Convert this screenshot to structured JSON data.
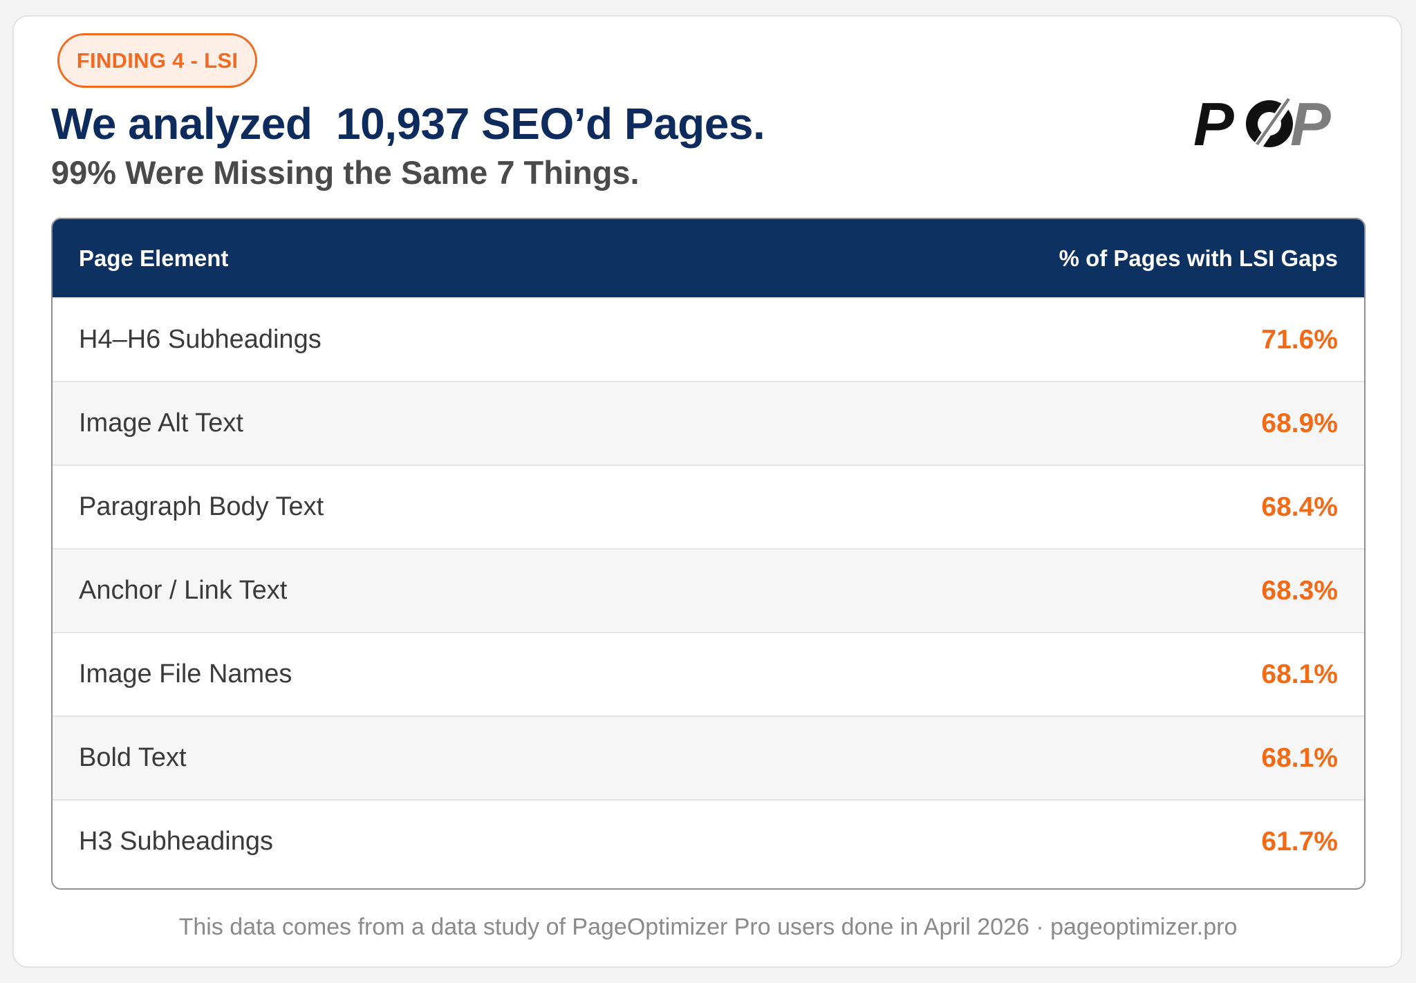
{
  "badge": "FINDING 4 - LSI",
  "title": "We analyzed  10,937 SEO’d Pages.",
  "subtitle": "99% Were Missing the Same 7 Things.",
  "logo": {
    "text": "POP",
    "colors": {
      "dark": "#111111",
      "gray": "#7d7d7d"
    }
  },
  "colors": {
    "accent": "#f26a15",
    "header_bg": "#0d3262",
    "title": "#0d2c5d"
  },
  "chart_data": {
    "type": "table",
    "columns": [
      "Page Element",
      "% of Pages with LSI Gaps"
    ],
    "rows": [
      {
        "element": "H4–H6 Subheadings",
        "value": "71.6%"
      },
      {
        "element": "Image Alt Text",
        "value": "68.9%"
      },
      {
        "element": "Paragraph Body Text",
        "value": "68.4%"
      },
      {
        "element": "Anchor / Link Text",
        "value": "68.3%"
      },
      {
        "element": "Image File Names",
        "value": "68.1%"
      },
      {
        "element": "Bold Text",
        "value": "68.1%"
      },
      {
        "element": "H3 Subheadings",
        "value": "61.7%"
      }
    ]
  },
  "footer": "This data comes from a data study of PageOptimizer Pro users done in April 2026 · pageoptimizer.pro"
}
